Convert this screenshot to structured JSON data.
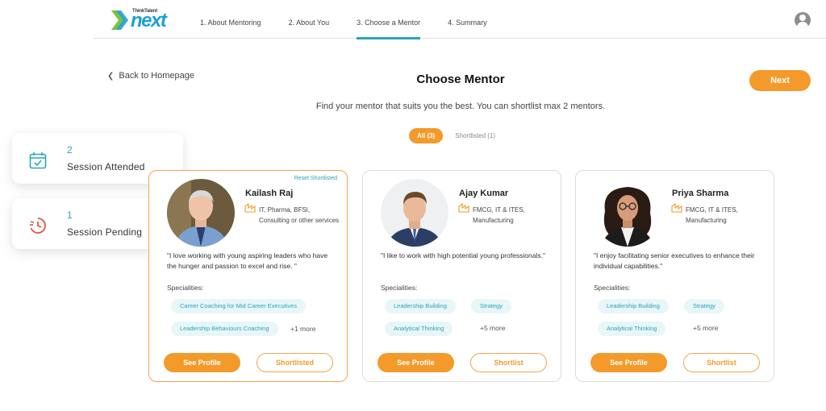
{
  "brand": {
    "small_text": "ThinkTalent",
    "big_text": "next"
  },
  "steps": [
    "1. About Mentoring",
    "2. About You",
    "3. Choose a Mentor",
    "4. Summary"
  ],
  "active_step": 2,
  "back_label": "Back to Homepage",
  "page_title": "Choose Mentor",
  "next_label": "Next",
  "subtitle": "Find your mentor that suits you the best. You can shortlist max 2 mentors.",
  "filters": {
    "all": "All (3)",
    "shortlisted": "Shortlisted (1)"
  },
  "stats": [
    {
      "value": "2",
      "label": "Session Attended",
      "icon": "calendar-check-icon"
    },
    {
      "value": "1",
      "label": "Session Pending",
      "icon": "clock-pending-icon"
    }
  ],
  "mentors": [
    {
      "name": "Kailash Raj",
      "industry": "IT, Pharma, BFSI, Consulting or other services",
      "quote": "\"I love working with young aspiring leaders who have the hunger and passion to excel and rise. \"",
      "chips": [
        "Career Coaching for Mid Career Executives",
        "Leadership Behaviours Coaching"
      ],
      "more": "+1 more",
      "see_profile": "See Profile",
      "shortlist_label": "Shortlisted",
      "reset": "Reset Shortlisted"
    },
    {
      "name": "Ajay Kumar",
      "industry": "FMCG, IT & ITES, Manufacturing",
      "quote": "\"I like to work with high potential young professionals.\"",
      "chips": [
        "Leadership Building",
        "Strategy",
        "Analytical Thinking"
      ],
      "more": "+5 more",
      "see_profile": "See Profile",
      "shortlist_label": "Shortlist"
    },
    {
      "name": "Priya Sharma",
      "industry": "FMCG, IT & ITES, Manufacturing",
      "quote": "\"I enjoy facilitating senior executives to enhance their individual capabilities.\"",
      "chips": [
        "Leadership Building",
        "Strategy",
        "Analytical Thinking"
      ],
      "more": "+5 more",
      "see_profile": "See Profile",
      "shortlist_label": "Shortlist"
    }
  ],
  "specialities_label": "Specialities:",
  "colors": {
    "accent_orange": "#f39a2b",
    "accent_teal": "#2aa6b5",
    "brand_blue": "#1d9fd6"
  }
}
